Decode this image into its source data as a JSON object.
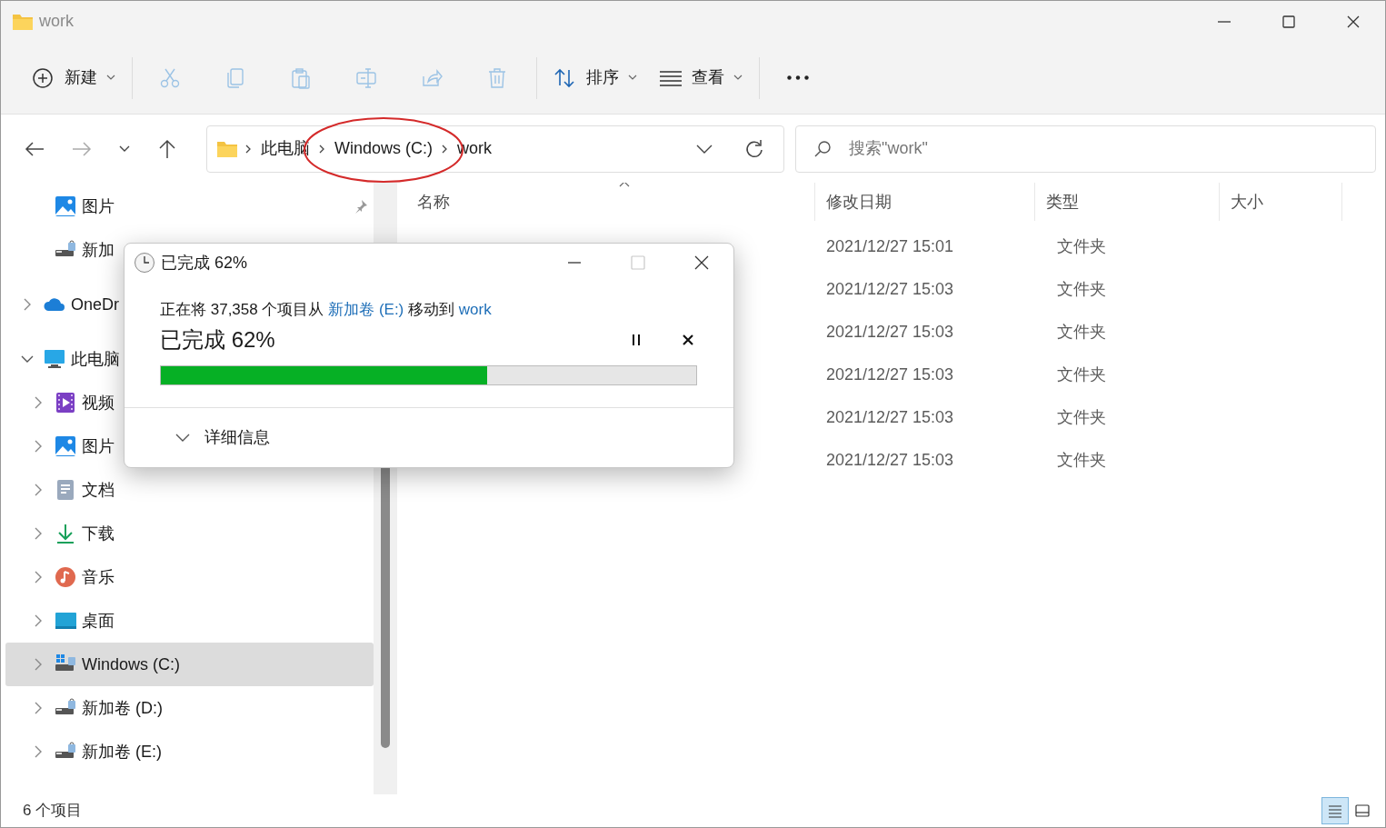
{
  "window": {
    "title": "work"
  },
  "toolbar": [
    {
      "kind": "new",
      "label": "新建",
      "disabled": false,
      "caret": true
    },
    {
      "kind": "cut",
      "disabled": true
    },
    {
      "kind": "copy",
      "disabled": true
    },
    {
      "kind": "paste",
      "disabled": true
    },
    {
      "kind": "rename",
      "disabled": true
    },
    {
      "kind": "share",
      "disabled": true
    },
    {
      "kind": "delete",
      "disabled": true
    },
    {
      "kind": "sort",
      "label": "排序",
      "disabled": false,
      "caret": true
    },
    {
      "kind": "view",
      "label": "查看",
      "disabled": false,
      "caret": true
    },
    {
      "kind": "more"
    }
  ],
  "navigation": {
    "back_disabled": false,
    "forward_disabled": true
  },
  "breadcrumb": [
    "此电脑",
    "Windows (C:)",
    "work"
  ],
  "search": {
    "placeholder": "搜索\"work\""
  },
  "sidebar": {
    "quick_access": [
      {
        "label": "图片",
        "kind": "pictures",
        "pinned": true,
        "selected": false
      },
      {
        "label": "新加",
        "kind": "drive",
        "pinned": false,
        "selected": false
      }
    ],
    "tree": [
      {
        "label": "OneDr",
        "kind": "cloud",
        "expanded": false,
        "selected": false
      },
      {
        "label": "此电脑",
        "kind": "pc",
        "expanded": true,
        "selected": false,
        "children": [
          {
            "label": "视频",
            "kind": "videos",
            "expanded": false,
            "selected": false
          },
          {
            "label": "图片",
            "kind": "pictures",
            "expanded": false,
            "selected": false
          },
          {
            "label": "文档",
            "kind": "documents",
            "expanded": false,
            "selected": false
          },
          {
            "label": "下载",
            "kind": "downloads",
            "expanded": false,
            "selected": false
          },
          {
            "label": "音乐",
            "kind": "music",
            "expanded": false,
            "selected": false
          },
          {
            "label": "桌面",
            "kind": "desktop",
            "expanded": false,
            "selected": false
          },
          {
            "label": "Windows (C:)",
            "kind": "system-drive",
            "expanded": false,
            "selected": true
          },
          {
            "label": "新加卷 (D:)",
            "kind": "drive",
            "expanded": false,
            "selected": false
          },
          {
            "label": "新加卷 (E:)",
            "kind": "drive",
            "expanded": false,
            "selected": false
          }
        ]
      }
    ]
  },
  "table": {
    "columns": [
      "名称",
      "修改日期",
      "类型",
      "大小"
    ],
    "rows": [
      {
        "modified": "2021/12/27 15:01",
        "type": "文件夹"
      },
      {
        "modified": "2021/12/27 15:03",
        "type": "文件夹"
      },
      {
        "modified": "2021/12/27 15:03",
        "type": "文件夹"
      },
      {
        "modified": "2021/12/27 15:03",
        "type": "文件夹"
      },
      {
        "modified": "2021/12/27 15:03",
        "type": "文件夹"
      },
      {
        "modified": "2021/12/27 15:03",
        "type": "文件夹"
      }
    ]
  },
  "status_bar": {
    "item_count": "6 个项目",
    "views": [
      {
        "kind": "details",
        "selected": true
      },
      {
        "kind": "tiles",
        "selected": false
      }
    ]
  },
  "progress_dialog": {
    "title": "已完成 62%",
    "maximize_disabled": true,
    "message": {
      "before": "正在将 37,358 个项目从",
      "source": "新加卷 (E:)",
      "middle": "移动到",
      "destination": "work"
    },
    "heading": "已完成 62%",
    "level": 0.61,
    "details_label": "详细信息",
    "details_expanded": false
  }
}
